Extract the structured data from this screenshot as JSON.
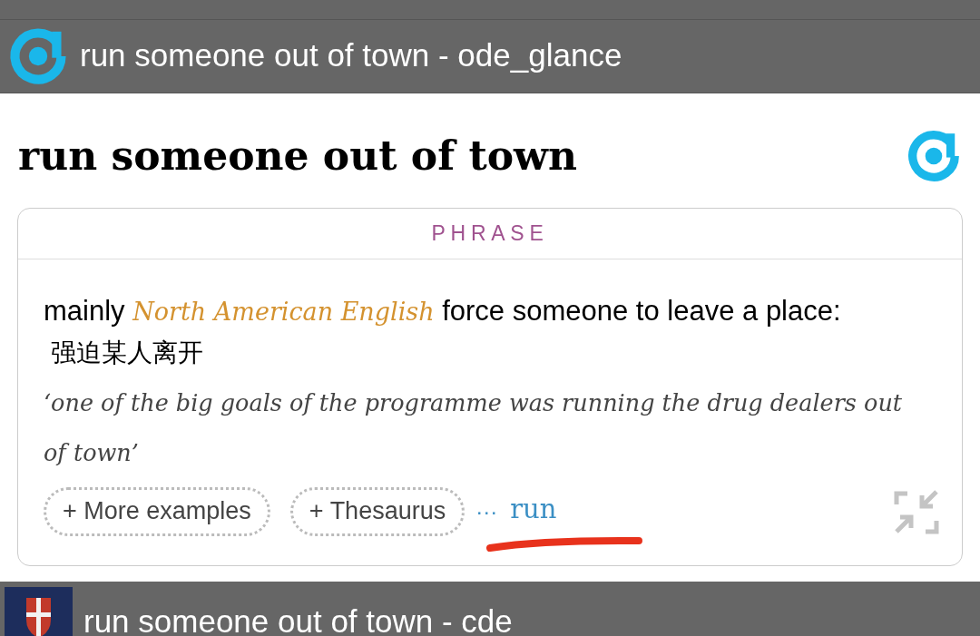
{
  "header": {
    "title": "run someone out of town - ode_glance"
  },
  "entry": {
    "headword": "run someone out of town",
    "section": {
      "label": "PHRASE",
      "definition": {
        "region": "mainly",
        "register": "North American English",
        "text": "force someone to leave a place:",
        "translation": "强迫某人离开"
      },
      "example": "‘one of the big goals of the programme was running the drug dealers out of town’",
      "buttons": [
        "+ More examples",
        "+ Thesaurus"
      ],
      "more": "···",
      "link": "run"
    }
  },
  "next_result": {
    "title": "run someone out of town - cde"
  }
}
